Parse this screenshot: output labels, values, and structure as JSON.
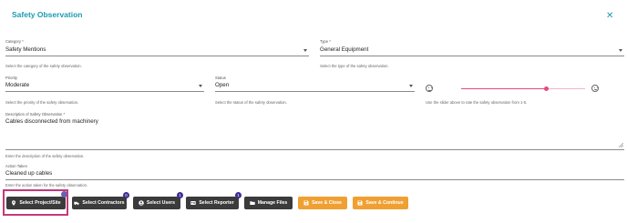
{
  "dialog": {
    "title": "Safety Observation",
    "close_glyph": "✕"
  },
  "category": {
    "label": "Category *",
    "value": "Safety Mentions",
    "help": "Select the category of the safety observation."
  },
  "type": {
    "label": "Type *",
    "value": "General Equipment",
    "help": "Select the type of the safety observation."
  },
  "priority": {
    "label": "Priority",
    "value": "Moderate",
    "help": "Select the priority of the safety observation."
  },
  "status": {
    "label": "Status",
    "value": "Open",
    "help": "Select the status of the safety observation."
  },
  "rating": {
    "help": "Use the slider above to rate the safety observation from 1-5.",
    "value": 3.75,
    "min": 1,
    "max": 5,
    "left_icon": "sad-face-icon",
    "right_icon": "happy-face-icon",
    "accent_color": "#e8497a"
  },
  "description": {
    "label": "Description of Safety Observation *",
    "value": "Cables disconnected from machinery",
    "help": "Enter the description of the safety observation."
  },
  "action": {
    "label": "Action Taken",
    "value": "Cleaned up cables",
    "help": "Enter the action taken for the safety observation."
  },
  "buttons": {
    "project_site": "Select Project/Site",
    "contractors": "Select Contractors",
    "contractors_badge": "0",
    "users": "Select Users",
    "users_badge": "1",
    "reporter": "Select Reporter",
    "reporter_badge": "1",
    "files": "Manage Files",
    "save_close": "Save & Close",
    "save_continue": "Save & Continue"
  },
  "colors": {
    "accent": "#1a9bb0",
    "dark_button": "#3b3b3b",
    "orange_button": "#f0a033",
    "badge": "#3a2f8f",
    "highlight": "#c3397a"
  }
}
